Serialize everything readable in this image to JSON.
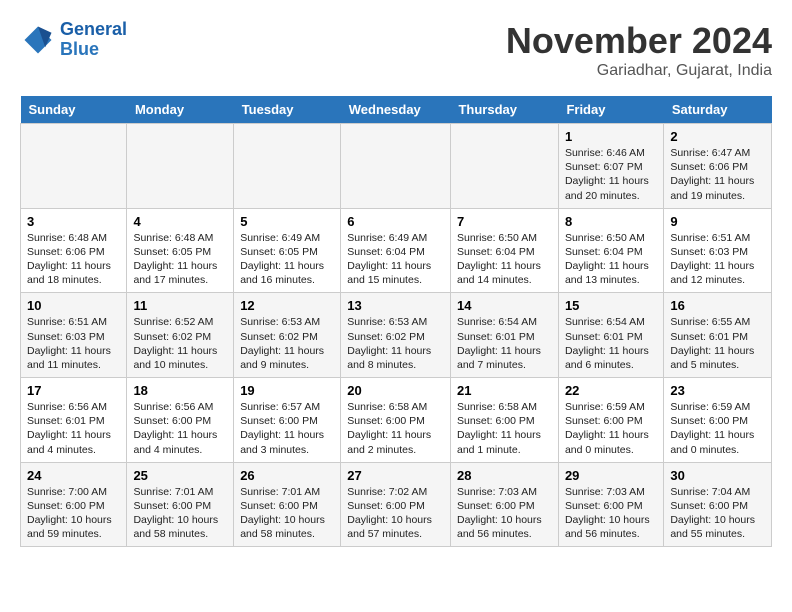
{
  "header": {
    "logo": {
      "line1": "General",
      "line2": "Blue"
    },
    "title": "November 2024",
    "subtitle": "Gariadhar, Gujarat, India"
  },
  "calendar": {
    "days_of_week": [
      "Sunday",
      "Monday",
      "Tuesday",
      "Wednesday",
      "Thursday",
      "Friday",
      "Saturday"
    ],
    "weeks": [
      [
        {
          "day": "",
          "info": ""
        },
        {
          "day": "",
          "info": ""
        },
        {
          "day": "",
          "info": ""
        },
        {
          "day": "",
          "info": ""
        },
        {
          "day": "",
          "info": ""
        },
        {
          "day": "1",
          "info": "Sunrise: 6:46 AM\nSunset: 6:07 PM\nDaylight: 11 hours and 20 minutes."
        },
        {
          "day": "2",
          "info": "Sunrise: 6:47 AM\nSunset: 6:06 PM\nDaylight: 11 hours and 19 minutes."
        }
      ],
      [
        {
          "day": "3",
          "info": "Sunrise: 6:48 AM\nSunset: 6:06 PM\nDaylight: 11 hours and 18 minutes."
        },
        {
          "day": "4",
          "info": "Sunrise: 6:48 AM\nSunset: 6:05 PM\nDaylight: 11 hours and 17 minutes."
        },
        {
          "day": "5",
          "info": "Sunrise: 6:49 AM\nSunset: 6:05 PM\nDaylight: 11 hours and 16 minutes."
        },
        {
          "day": "6",
          "info": "Sunrise: 6:49 AM\nSunset: 6:04 PM\nDaylight: 11 hours and 15 minutes."
        },
        {
          "day": "7",
          "info": "Sunrise: 6:50 AM\nSunset: 6:04 PM\nDaylight: 11 hours and 14 minutes."
        },
        {
          "day": "8",
          "info": "Sunrise: 6:50 AM\nSunset: 6:04 PM\nDaylight: 11 hours and 13 minutes."
        },
        {
          "day": "9",
          "info": "Sunrise: 6:51 AM\nSunset: 6:03 PM\nDaylight: 11 hours and 12 minutes."
        }
      ],
      [
        {
          "day": "10",
          "info": "Sunrise: 6:51 AM\nSunset: 6:03 PM\nDaylight: 11 hours and 11 minutes."
        },
        {
          "day": "11",
          "info": "Sunrise: 6:52 AM\nSunset: 6:02 PM\nDaylight: 11 hours and 10 minutes."
        },
        {
          "day": "12",
          "info": "Sunrise: 6:53 AM\nSunset: 6:02 PM\nDaylight: 11 hours and 9 minutes."
        },
        {
          "day": "13",
          "info": "Sunrise: 6:53 AM\nSunset: 6:02 PM\nDaylight: 11 hours and 8 minutes."
        },
        {
          "day": "14",
          "info": "Sunrise: 6:54 AM\nSunset: 6:01 PM\nDaylight: 11 hours and 7 minutes."
        },
        {
          "day": "15",
          "info": "Sunrise: 6:54 AM\nSunset: 6:01 PM\nDaylight: 11 hours and 6 minutes."
        },
        {
          "day": "16",
          "info": "Sunrise: 6:55 AM\nSunset: 6:01 PM\nDaylight: 11 hours and 5 minutes."
        }
      ],
      [
        {
          "day": "17",
          "info": "Sunrise: 6:56 AM\nSunset: 6:01 PM\nDaylight: 11 hours and 4 minutes."
        },
        {
          "day": "18",
          "info": "Sunrise: 6:56 AM\nSunset: 6:00 PM\nDaylight: 11 hours and 4 minutes."
        },
        {
          "day": "19",
          "info": "Sunrise: 6:57 AM\nSunset: 6:00 PM\nDaylight: 11 hours and 3 minutes."
        },
        {
          "day": "20",
          "info": "Sunrise: 6:58 AM\nSunset: 6:00 PM\nDaylight: 11 hours and 2 minutes."
        },
        {
          "day": "21",
          "info": "Sunrise: 6:58 AM\nSunset: 6:00 PM\nDaylight: 11 hours and 1 minute."
        },
        {
          "day": "22",
          "info": "Sunrise: 6:59 AM\nSunset: 6:00 PM\nDaylight: 11 hours and 0 minutes."
        },
        {
          "day": "23",
          "info": "Sunrise: 6:59 AM\nSunset: 6:00 PM\nDaylight: 11 hours and 0 minutes."
        }
      ],
      [
        {
          "day": "24",
          "info": "Sunrise: 7:00 AM\nSunset: 6:00 PM\nDaylight: 10 hours and 59 minutes."
        },
        {
          "day": "25",
          "info": "Sunrise: 7:01 AM\nSunset: 6:00 PM\nDaylight: 10 hours and 58 minutes."
        },
        {
          "day": "26",
          "info": "Sunrise: 7:01 AM\nSunset: 6:00 PM\nDaylight: 10 hours and 58 minutes."
        },
        {
          "day": "27",
          "info": "Sunrise: 7:02 AM\nSunset: 6:00 PM\nDaylight: 10 hours and 57 minutes."
        },
        {
          "day": "28",
          "info": "Sunrise: 7:03 AM\nSunset: 6:00 PM\nDaylight: 10 hours and 56 minutes."
        },
        {
          "day": "29",
          "info": "Sunrise: 7:03 AM\nSunset: 6:00 PM\nDaylight: 10 hours and 56 minutes."
        },
        {
          "day": "30",
          "info": "Sunrise: 7:04 AM\nSunset: 6:00 PM\nDaylight: 10 hours and 55 minutes."
        }
      ]
    ]
  }
}
